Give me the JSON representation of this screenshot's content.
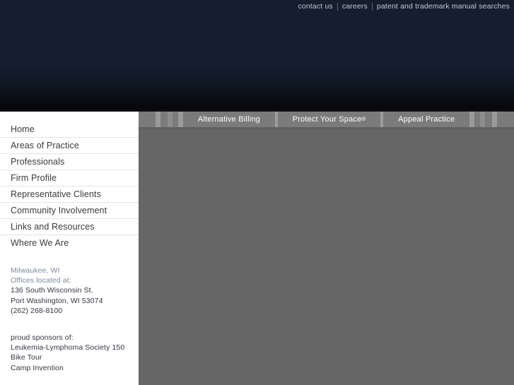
{
  "header": {
    "top_nav": {
      "links": [
        {
          "label": "contact us"
        },
        {
          "label": "careers"
        },
        {
          "label": "patent and trademark manual searches"
        }
      ]
    }
  },
  "tabs": [
    {
      "label": "Alternative Billing",
      "trademark": ""
    },
    {
      "label": "Protect Your Space",
      "trademark": "®"
    },
    {
      "label": "Appeal Practice",
      "trademark": ""
    }
  ],
  "sidebar": {
    "nav_items": [
      {
        "label": "Home"
      },
      {
        "label": "Areas of Practice"
      },
      {
        "label": "Professionals"
      },
      {
        "label": "Firm Profile"
      },
      {
        "label": "Representative Clients"
      },
      {
        "label": "Community Involvement"
      },
      {
        "label": "Links and Resources"
      },
      {
        "label": "Where We Are"
      }
    ],
    "address": {
      "city": "Milwaukee, WI",
      "offices_label": "Offices located at:",
      "street": "136 South Wisconsin St.",
      "city_state_zip": "Port Washington, WI 53074",
      "phone": "(262) 268-8100"
    },
    "sponsors": {
      "heading": "proud sponsors of:",
      "line1": "Leukemia-Lymphoma Society 150",
      "line2": "Bike Tour",
      "line3": "Camp Invention"
    }
  },
  "colors": {
    "header_navy": "#151e2e",
    "header_bottom": "#07080c",
    "content_grey": "#666666",
    "tab_bar_grey": "#7b7b7b",
    "tab_divider": "#9c9c9c",
    "sidebar_bg": "#ffffff",
    "muted_blue": "#7e8ba0"
  }
}
